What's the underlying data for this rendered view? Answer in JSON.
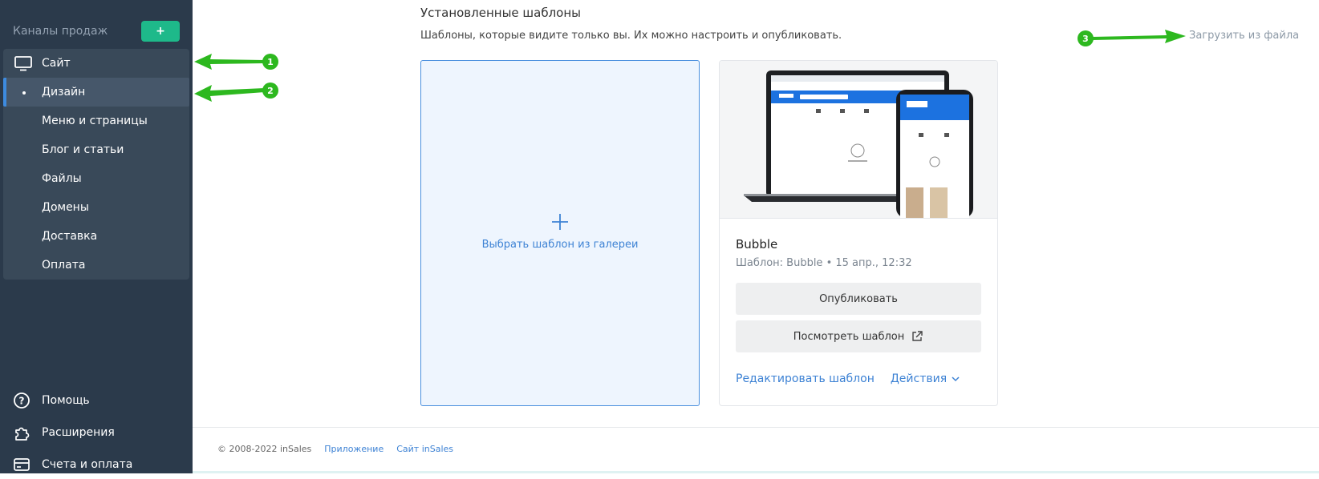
{
  "sidebar": {
    "header_label": "Каналы продаж",
    "add_label": "+",
    "items": [
      {
        "label": "Сайт"
      },
      {
        "label": "Дизайн"
      },
      {
        "label": "Меню и страницы"
      },
      {
        "label": "Блог и статьи"
      },
      {
        "label": "Файлы"
      },
      {
        "label": "Домены"
      },
      {
        "label": "Доставка"
      },
      {
        "label": "Оплата"
      }
    ],
    "bottom": [
      {
        "label": "Помощь",
        "icon": "help-icon"
      },
      {
        "label": "Расширения",
        "icon": "puzzle-icon"
      },
      {
        "label": "Счета и оплата",
        "icon": "card-icon"
      }
    ]
  },
  "main": {
    "title": "Установленные шаблоны",
    "subtitle": "Шаблоны, которые видите только вы. Их можно настроить и опубликовать.",
    "upload_link": "Загрузить из файла",
    "gallery_card": {
      "label": "Выбрать шаблон из галереи"
    },
    "template_card": {
      "name": "Bubble",
      "meta": "Шаблон: Bubble • 15 апр., 12:32",
      "publish_label": "Опубликовать",
      "view_label": "Посмотреть шаблон",
      "edit_label": "Редактировать шаблон",
      "actions_label": "Действия"
    }
  },
  "footer": {
    "copyright": "© 2008-2022 inSales",
    "link_app": "Приложение",
    "link_site": "Сайт inSales"
  },
  "annotations": [
    "1",
    "2",
    "3"
  ],
  "colors": {
    "sidebar_bg": "#2b3a4b",
    "accent_green": "#1eb98a",
    "link_blue": "#3d82d4",
    "annotation_green": "#2db81f"
  }
}
